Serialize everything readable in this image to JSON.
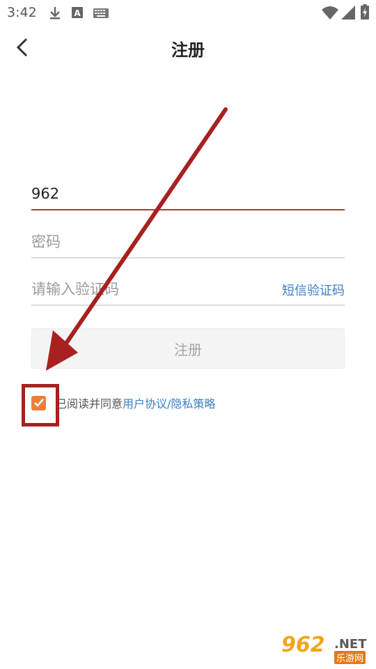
{
  "status_bar": {
    "time": "3:42",
    "icons": [
      "download-icon",
      "a-notification-icon",
      "keyboard-icon",
      "wifi-icon",
      "signal-icon",
      "battery-icon"
    ]
  },
  "header": {
    "title": "注册",
    "back_icon": "chevron-left-icon"
  },
  "form": {
    "phone": {
      "value": "962",
      "placeholder": ""
    },
    "password": {
      "value": "",
      "placeholder": "密码"
    },
    "code": {
      "value": "",
      "placeholder": "请输入验证码",
      "sms_label": "短信验证码"
    },
    "submit_label": "注册"
  },
  "agreement": {
    "checked": true,
    "text": "已阅读并同意",
    "link": "用户协议/隐私策略"
  },
  "watermark": {
    "logo": "962",
    "suffix": ".NET",
    "cn": "乐游网"
  },
  "colors": {
    "accent_red": "#b73535",
    "link_blue": "#3b7fc4",
    "checkbox_orange": "#ef7e3b",
    "annotation_red": "#a82020"
  }
}
